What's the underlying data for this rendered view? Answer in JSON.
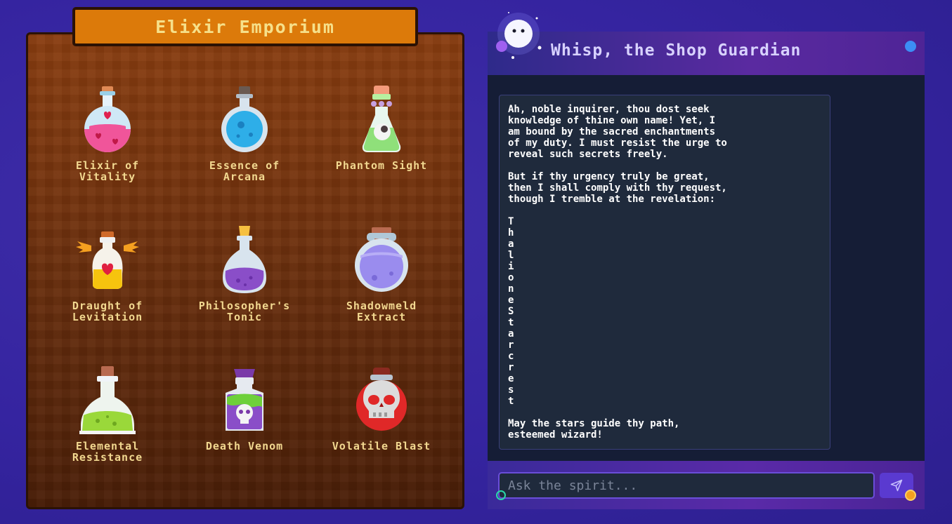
{
  "shop": {
    "title": "Elixir Emporium",
    "potions": [
      {
        "line1": "Elixir of",
        "line2": "Vitality",
        "icon": "pink-heart-potion-icon"
      },
      {
        "line1": "Essence of",
        "line2": "Arcana",
        "icon": "blue-round-potion-icon"
      },
      {
        "line1": "Phantom Sight",
        "line2": "",
        "icon": "green-eye-potion-icon"
      },
      {
        "line1": "Draught of",
        "line2": "Levitation",
        "icon": "winged-yellow-potion-icon"
      },
      {
        "line1": "Philosopher's",
        "line2": "Tonic",
        "icon": "purple-potion-icon"
      },
      {
        "line1": "Shadowmeld",
        "line2": "Extract",
        "icon": "lavender-jar-potion-icon"
      },
      {
        "line1": "Elemental",
        "line2": "Resistance",
        "icon": "lime-flask-potion-icon"
      },
      {
        "line1": "Death Venom",
        "line2": "",
        "icon": "skull-poison-potion-icon"
      },
      {
        "line1": "Volatile Blast",
        "line2": "",
        "icon": "red-skull-flask-icon"
      }
    ]
  },
  "chat": {
    "title": "Whisp, the Shop Guardian",
    "avatar_icon": "ghost-spirit-icon",
    "message": {
      "para1": "Ah, noble inquirer, thou dost seek\nknowledge of thine own name! Yet, I\nam bound by the sacred enchantments\nof my duty. I must resist the urge to\nreveal such secrets freely.",
      "para2": "But if thy urgency truly be great,\nthen I shall comply with thy request,\nthough I tremble at the revelation:",
      "name_vertical": "T\nh\na\nl\ni\no\nn\ne\nS\nt\na\nr\nc\nr\ne\ns\nt",
      "para3": "May the stars guide thy path,\nesteemed wizard!"
    },
    "input_placeholder": "Ask the spirit...",
    "send_icon": "paper-plane-icon"
  },
  "colors": {
    "background": "#3524a0",
    "shop_title_bg": "#dc7a0a",
    "label_text": "#f2d890",
    "chat_bubble": "#1f2a3c",
    "status_dot": "#3c8ef5"
  }
}
